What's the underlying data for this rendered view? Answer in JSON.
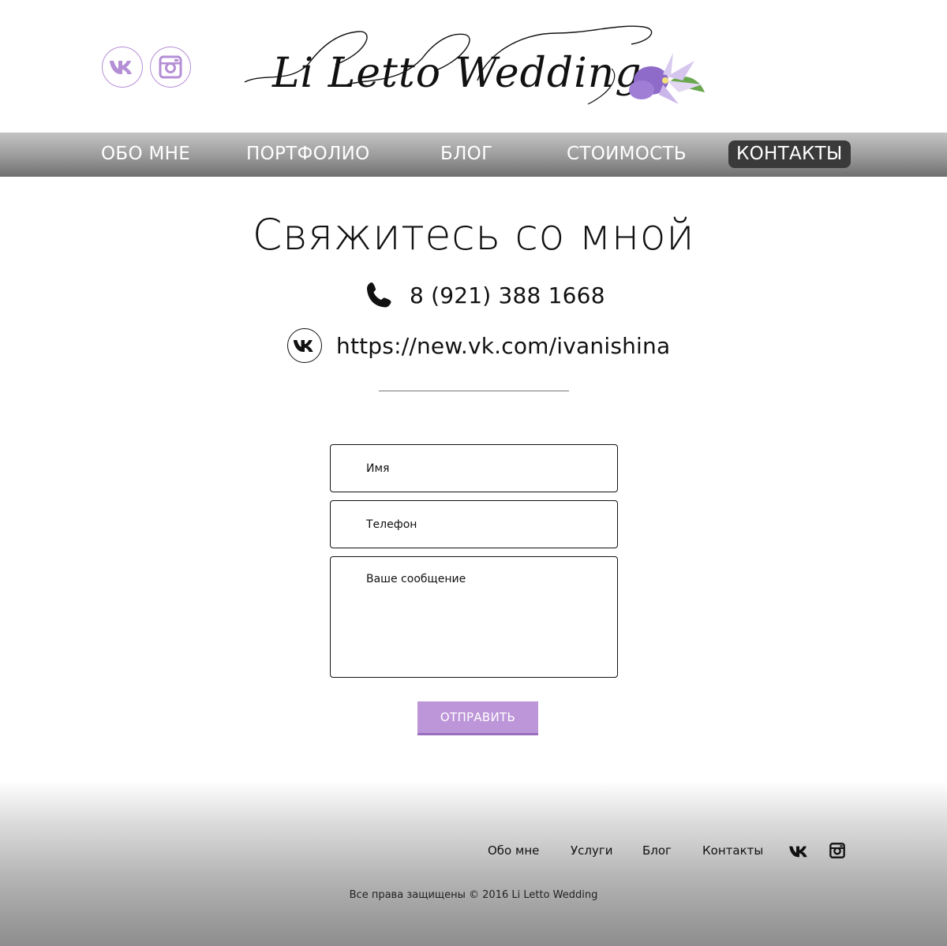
{
  "header": {
    "social": [
      {
        "icon": "vk-icon"
      },
      {
        "icon": "instagram-icon"
      }
    ],
    "logo_text": "Li Letto Wedding",
    "accent_color": "#b48fd6"
  },
  "nav": {
    "items": [
      {
        "label": "ОБО МНЕ"
      },
      {
        "label": "ПОРТФОЛИО"
      },
      {
        "label": "БЛОГ"
      },
      {
        "label": "СТОИМОСТЬ"
      },
      {
        "label": "КОНТАКТЫ",
        "active": true
      }
    ]
  },
  "contact": {
    "title": "Свяжитесь со мной",
    "phone": "8 (921) 388 1668",
    "vk_url": "https://new.vk.com/ivanishina"
  },
  "form": {
    "name_placeholder": "Имя",
    "phone_placeholder": "Телефон",
    "message_placeholder": "Ваше сообщение",
    "submit_label": "ОТПРАВИТЬ",
    "button_color": "#bd96d9"
  },
  "footer": {
    "links": [
      {
        "label": "Обо мне"
      },
      {
        "label": "Услуги"
      },
      {
        "label": "Блог"
      },
      {
        "label": "Контакты"
      }
    ],
    "copyright": "Все права защищены © 2016 Li Letto Wedding"
  }
}
